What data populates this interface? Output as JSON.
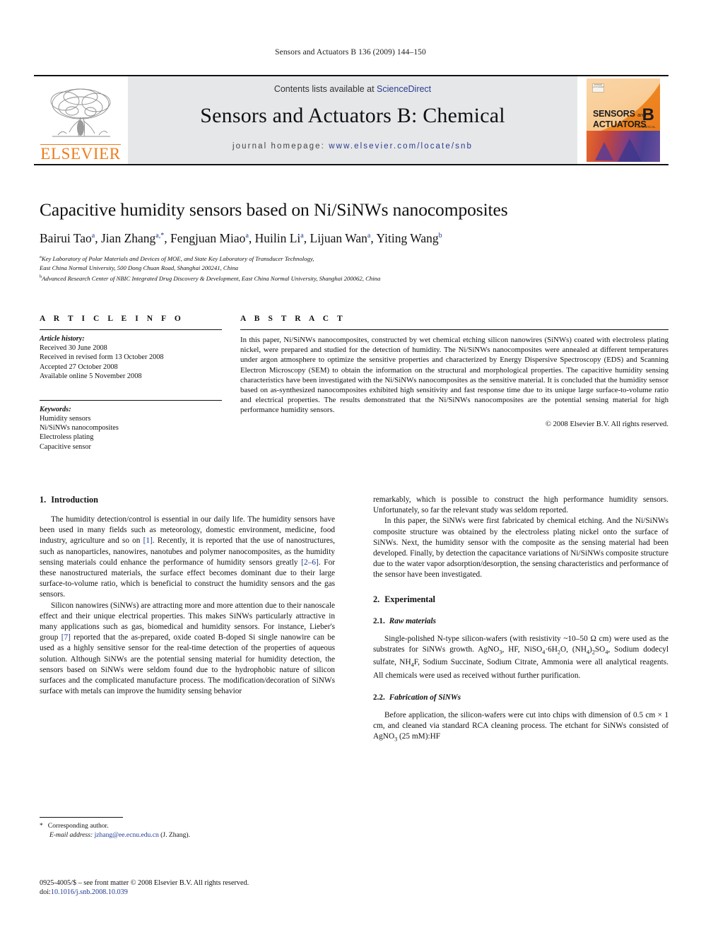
{
  "running_head": "Sensors and Actuators B 136 (2009) 144–150",
  "masthead": {
    "contents_prefix": "Contents lists available at ",
    "sciencedirect": "ScienceDirect",
    "journal_title": "Sensors and Actuators B: Chemical",
    "homepage_label": "journal homepage:",
    "homepage_url": "www.elsevier.com/locate/snb",
    "publisher_logo_text": "ELSEVIER",
    "cover": {
      "line1": "SENSORS",
      "and": "and",
      "line2": "ACTUATORS",
      "letter": "B",
      "chemical": "CHEMICAL",
      "badge": "SENSORS\nACTUATORS"
    },
    "accent_orange": "#ef7c1a",
    "link_blue": "#2a3c8f",
    "band_gray": "#e6e7e9"
  },
  "article": {
    "title": "Capacitive humidity sensors based on Ni/SiNWs nanocomposites",
    "authors": [
      {
        "name": "Bairui Tao",
        "marks": "a"
      },
      {
        "name": "Jian Zhang",
        "marks": "a,*"
      },
      {
        "name": "Fengjuan Miao",
        "marks": "a"
      },
      {
        "name": "Huilin Li",
        "marks": "a"
      },
      {
        "name": "Lijuan Wan",
        "marks": "a"
      },
      {
        "name": "Yiting Wang",
        "marks": "b"
      }
    ],
    "affiliations": [
      {
        "mark": "a",
        "text": "Key Laboratory of Polar Materials and Devices of MOE, and State Key Laboratory of Transducer Technology,"
      },
      {
        "mark": "",
        "text": "East China Normal University, 500 Dong Chuan Road, Shanghai 200241, China"
      },
      {
        "mark": "b",
        "text": "Advanced Research Center of NBIC Integrated Drug Discovery & Development, East China Normal University, Shanghai 200062, China"
      }
    ]
  },
  "article_info": {
    "heading": "A R T I C L E   I N F O",
    "history_label": "Article history:",
    "history": [
      "Received 30 June 2008",
      "Received in revised form 13 October 2008",
      "Accepted 27 October 2008",
      "Available online 5 November 2008"
    ],
    "keywords_label": "Keywords:",
    "keywords": [
      "Humidity sensors",
      "Ni/SiNWs nanocomposites",
      "Electroless plating",
      "Capacitive sensor"
    ]
  },
  "abstract": {
    "heading": "A B S T R A C T",
    "text": "In this paper, Ni/SiNWs nanocomposites, constructed by wet chemical etching silicon nanowires (SiNWs) coated with electroless plating nickel, were prepared and studied for the detection of humidity. The Ni/SiNWs nanocomposites were annealed at different temperatures under argon atmosphere to optimize the sensitive properties and characterized by Energy Dispersive Spectroscopy (EDS) and Scanning Electron Microscopy (SEM) to obtain the information on the structural and morphological properties. The capacitive humidity sensing characteristics have been investigated with the Ni/SiNWs nanocomposites as the sensitive material. It is concluded that the humidity sensor based on as-synthesized nanocomposites exhibited high sensitivity and fast response time due to its unique large surface-to-volume ratio and electrical properties. The results demonstrated that the Ni/SiNWs nanocomposites are the potential sensing material for high performance humidity sensors.",
    "copyright": "© 2008 Elsevier B.V. All rights reserved."
  },
  "sections": {
    "introduction": {
      "number": "1.",
      "title": "Introduction",
      "p1_a": "The humidity detection/control is essential in our daily life. The humidity sensors have been used in many fields such as meteorology, domestic environment, medicine, food industry, agriculture and so on ",
      "p1_ref1": "[1]",
      "p1_b": ". Recently, it is reported that the use of nanostructures, such as nanoparticles, nanowires, nanotubes and polymer nanocomposites, as the humidity sensing materials could enhance the performance of humidity sensors greatly ",
      "p1_ref2": "[2–6]",
      "p1_c": ". For these nanostructured materials, the surface effect becomes dominant due to their large surface-to-volume ratio, which is beneficial to construct the humidity sensors and the gas sensors.",
      "p2_a": "Silicon nanowires (SiNWs) are attracting more and more attention due to their nanoscale effect and their unique electrical properties. This makes SiNWs particularly attractive in many applications such as gas, biomedical and humidity sensors. For instance, Lieber's group ",
      "p2_ref": "[7]",
      "p2_b": " reported that the as-prepared, oxide coated B-doped Si single nanowire can be used as a highly sensitive sensor for the real-time detection of the properties of aqueous solution. Although SiNWs are the potential sensing material for humidity detection, the sensors based on SiNWs were seldom found due to the hydrophobic nature of silicon surfaces and the complicated manufacture process. The modification/decoration of SiNWs surface with metals can improve the humidity sensing behavior",
      "p3": "remarkably, which is possible to construct the high performance humidity sensors. Unfortunately, so far the relevant study was seldom reported.",
      "p4": "In this paper, the SiNWs were first fabricated by chemical etching. And the Ni/SiNWs composite structure was obtained by the electroless plating nickel onto the surface of SiNWs. Next, the humidity sensor with the composite as the sensing material had been developed. Finally, by detection the capacitance variations of Ni/SiNWs composite structure due to the water vapor adsorption/desorption, the sensing characteristics and performance of the sensor have been investigated."
    },
    "experimental": {
      "number": "2.",
      "title": "Experimental",
      "sub1_number": "2.1.",
      "sub1_title": "Raw materials",
      "sub1_p_a": "Single-polished N-type silicon-wafers (with resistivity ~10–50 Ω cm) were used as the substrates for SiNWs growth. AgNO",
      "sub1_p_b": ", HF, NiSO",
      "sub1_p_c": "·6H",
      "sub1_p_d": "O, (NH",
      "sub1_p_e": ")",
      "sub1_p_f": "SO",
      "sub1_p_g": ", Sodium dodecyl sulfate, NH",
      "sub1_p_h": "F, Sodium Succinate, Sodium Citrate, Ammonia were all analytical reagents. All chemicals were used as received without further purification.",
      "sub2_number": "2.2.",
      "sub2_title": "Fabrication of SiNWs",
      "sub2_p_a": "Before application, the silicon-wafers were cut into chips with dimension of 0.5 cm × 1 cm, and cleaned via standard RCA cleaning process. The etchant for SiNWs consisted of AgNO",
      "sub2_p_b": " (25 mM):HF"
    }
  },
  "footnote": {
    "star": "*",
    "corresponding": "Corresponding author.",
    "email_label": "E-mail address:",
    "email": "jzhang@ee.ecnu.edu.cn",
    "email_owner": "(J. Zhang)."
  },
  "page_footer": {
    "issn_line": "0925-4005/$ – see front matter © 2008 Elsevier B.V. All rights reserved.",
    "doi_label": "doi:",
    "doi": "10.1016/j.snb.2008.10.039"
  }
}
